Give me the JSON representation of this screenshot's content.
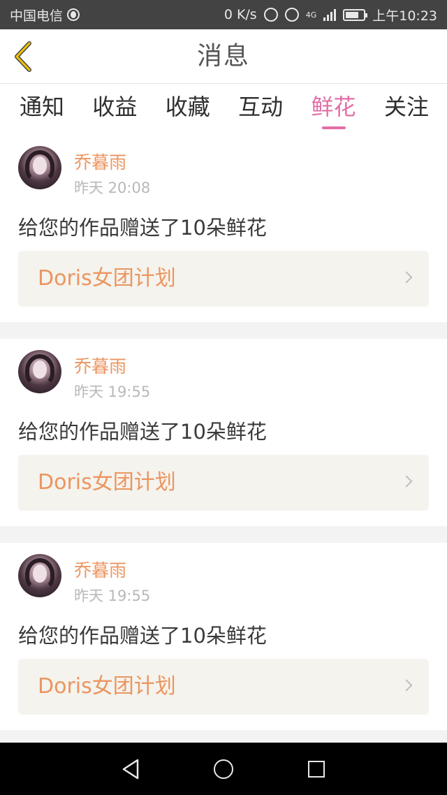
{
  "status_bar": {
    "carrier": "中国电信",
    "speed": "0 K/s",
    "network": "4G",
    "time": "上午10:23"
  },
  "header": {
    "title": "消息",
    "back_icon": "chevron-left-icon",
    "accent_color": "#f2c300"
  },
  "tabs": [
    {
      "label": "通知"
    },
    {
      "label": "收益"
    },
    {
      "label": "收藏"
    },
    {
      "label": "互动"
    },
    {
      "label": "鲜花",
      "active": true
    },
    {
      "label": "关注"
    }
  ],
  "colors": {
    "active_tab": "#e26ea6",
    "accent_orange": "#ec9560",
    "card_bg": "#f4f3ee"
  },
  "messages": [
    {
      "user": "乔暮雨",
      "time": "昨天 20:08",
      "text": "给您的作品赠送了10朵鲜花",
      "work": "Doris女团计划"
    },
    {
      "user": "乔暮雨",
      "time": "昨天 19:55",
      "text": "给您的作品赠送了10朵鲜花",
      "work": "Doris女团计划"
    },
    {
      "user": "乔暮雨",
      "time": "昨天 19:55",
      "text": "给您的作品赠送了10朵鲜花",
      "work": "Doris女团计划"
    }
  ],
  "nav_bar": {
    "back_icon": "triangle-back-icon",
    "home_icon": "circle-home-icon",
    "recent_icon": "square-recents-icon"
  }
}
